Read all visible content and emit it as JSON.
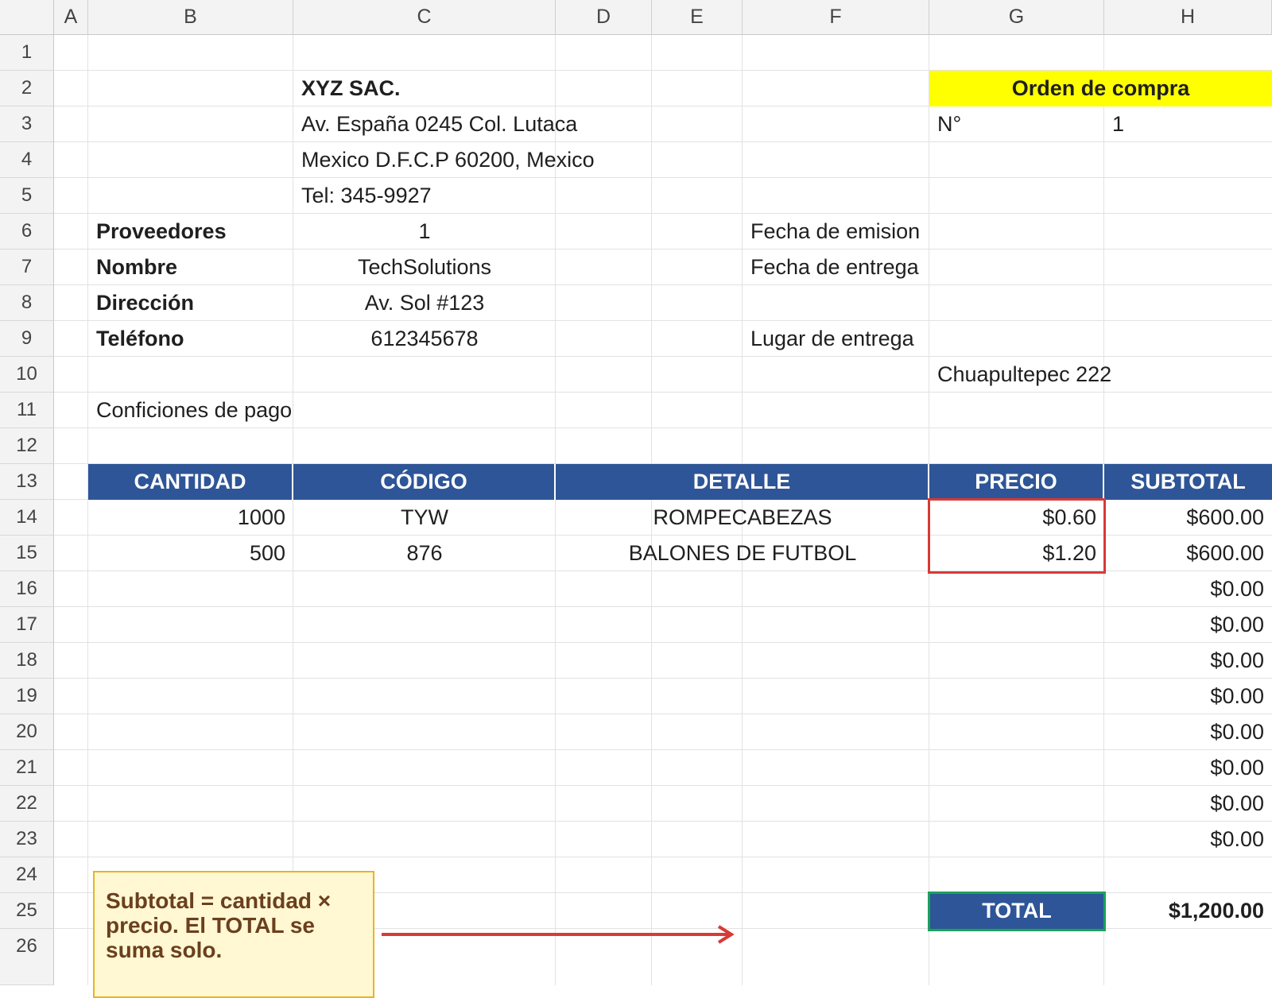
{
  "columns": [
    "A",
    "B",
    "C",
    "D",
    "E",
    "F",
    "G",
    "H"
  ],
  "rows": [
    "1",
    "2",
    "3",
    "4",
    "5",
    "6",
    "7",
    "8",
    "9",
    "10",
    "11",
    "12",
    "13",
    "14",
    "15",
    "16",
    "17",
    "18",
    "19",
    "20",
    "21",
    "22",
    "23",
    "24",
    "25",
    "26"
  ],
  "company": {
    "name": "XYZ SAC.",
    "address1": "Av. España 0245 Col. Lutaca",
    "address2": "Mexico D.F.C.P 60200, Mexico",
    "phone": "Tel: 345-9927"
  },
  "order": {
    "title": "Orden de compra",
    "number_label": "N°",
    "number_value": "1"
  },
  "supplier": {
    "label": "Proveedores",
    "value": "1",
    "name_label": "Nombre",
    "name_value": "TechSolutions",
    "address_label": "Dirección",
    "address_value": "Av. Sol #123",
    "phone_label": "Teléfono",
    "phone_value": "612345678"
  },
  "dates": {
    "issue_label": "Fecha de emision",
    "delivery_label": "Fecha de entrega",
    "place_label": "Lugar de entrega",
    "place_value": "Chuapultepec 222"
  },
  "payment_label": "Conficiones de pago",
  "table": {
    "headers": {
      "qty": "CANTIDAD",
      "code": "CÓDIGO",
      "detail": "DETALLE",
      "price": "PRECIO",
      "subtotal": "SUBTOTAL"
    },
    "rows": [
      {
        "qty": "1000",
        "code": "TYW",
        "detail": "ROMPECABEZAS",
        "price": "$0.60",
        "subtotal": "$600.00"
      },
      {
        "qty": "500",
        "code": "876",
        "detail": "BALONES DE FUTBOL",
        "price": "$1.20",
        "subtotal": "$600.00"
      }
    ],
    "empty_subtotals": [
      "$0.00",
      "$0.00",
      "$0.00",
      "$0.00",
      "$0.00",
      "$0.00",
      "$0.00",
      "$0.00"
    ],
    "total_label": "TOTAL",
    "total_value": "$1,200.00"
  },
  "note": {
    "text": "Subtotal = cantidad × precio. El TOTAL se suma solo."
  },
  "colors": {
    "header_blue": "#2e5597",
    "title_yellow": "#ffff00",
    "highlight_red": "#d83a35",
    "highlight_green": "#1aa35a",
    "note_bg": "#fff8d2"
  }
}
